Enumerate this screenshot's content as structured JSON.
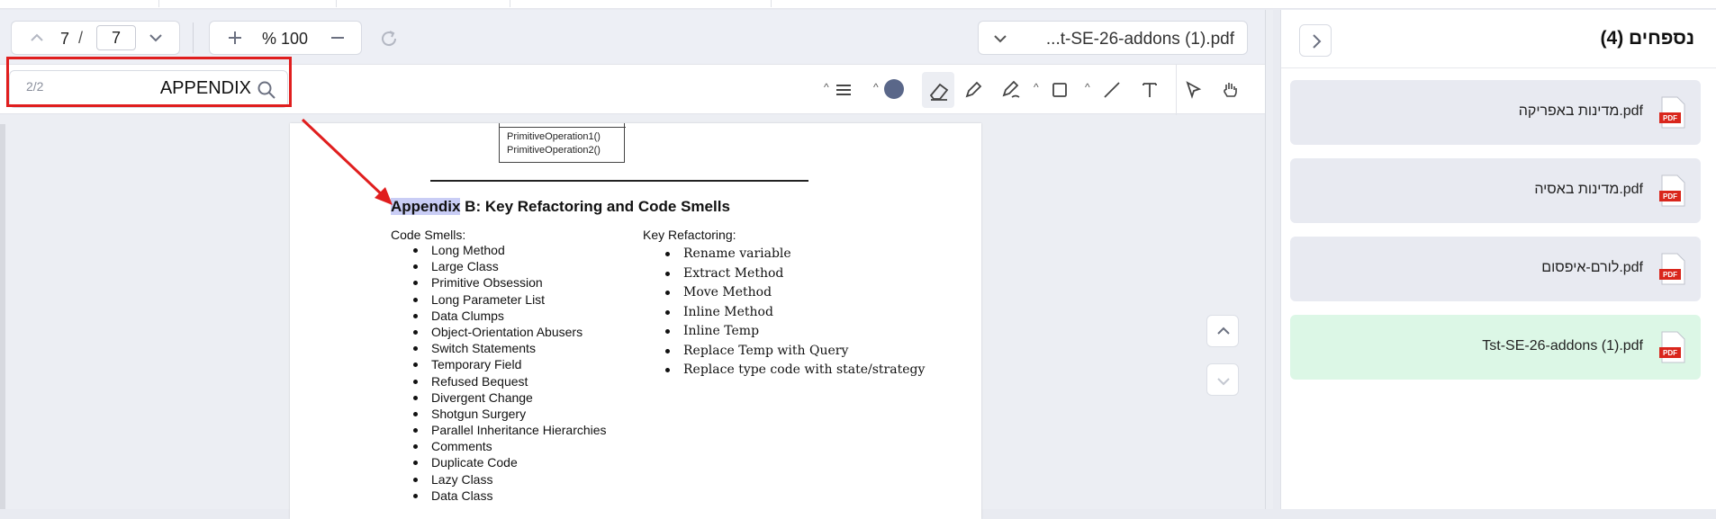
{
  "toolbar": {
    "page_current": "7",
    "page_separator": "/",
    "page_total": "7",
    "zoom_value": "% 100",
    "file_name": "...t-SE-26-addons (1).pdf"
  },
  "search": {
    "count": "2/2",
    "value": "APPENDIX"
  },
  "document": {
    "uml_lines": [
      "PrimitiveOperation1()",
      "PrimitiveOperation2()"
    ],
    "heading_highlight": "Appendix",
    "heading_rest": " B:  Key Refactoring and Code Smells",
    "left_title": "Code Smells:",
    "left_items": [
      "Long Method",
      "Large Class",
      "Primitive Obsession",
      "Long Parameter List",
      "Data Clumps",
      "Object-Orientation Abusers",
      "Switch Statements",
      "Temporary Field",
      "Refused Bequest",
      "Divergent Change",
      "Shotgun Surgery",
      "Parallel Inheritance Hierarchies",
      "Comments",
      "Duplicate Code",
      "Lazy Class",
      "Data Class"
    ],
    "right_title": "Key Refactoring:",
    "right_items": [
      "Rename variable",
      "Extract Method",
      "Move Method",
      "Inline Method",
      "Inline Temp",
      "Replace Temp with Query",
      "Replace type code with state/strategy"
    ]
  },
  "sidebar": {
    "title": "נספחים (4)",
    "attachments": [
      {
        "name": "מדינות באפריקה.pdf",
        "selected": false
      },
      {
        "name": "מדינות באסיה.pdf",
        "selected": false
      },
      {
        "name": "לורם-איפסום.pdf",
        "selected": false
      },
      {
        "name": "Tst-SE-26-addons (1).pdf",
        "selected": true
      }
    ]
  },
  "colors": {
    "annotation_color": "#5a6789",
    "highlight_frame": "#e01e1e",
    "selected_attachment": "#dcf7e6"
  }
}
